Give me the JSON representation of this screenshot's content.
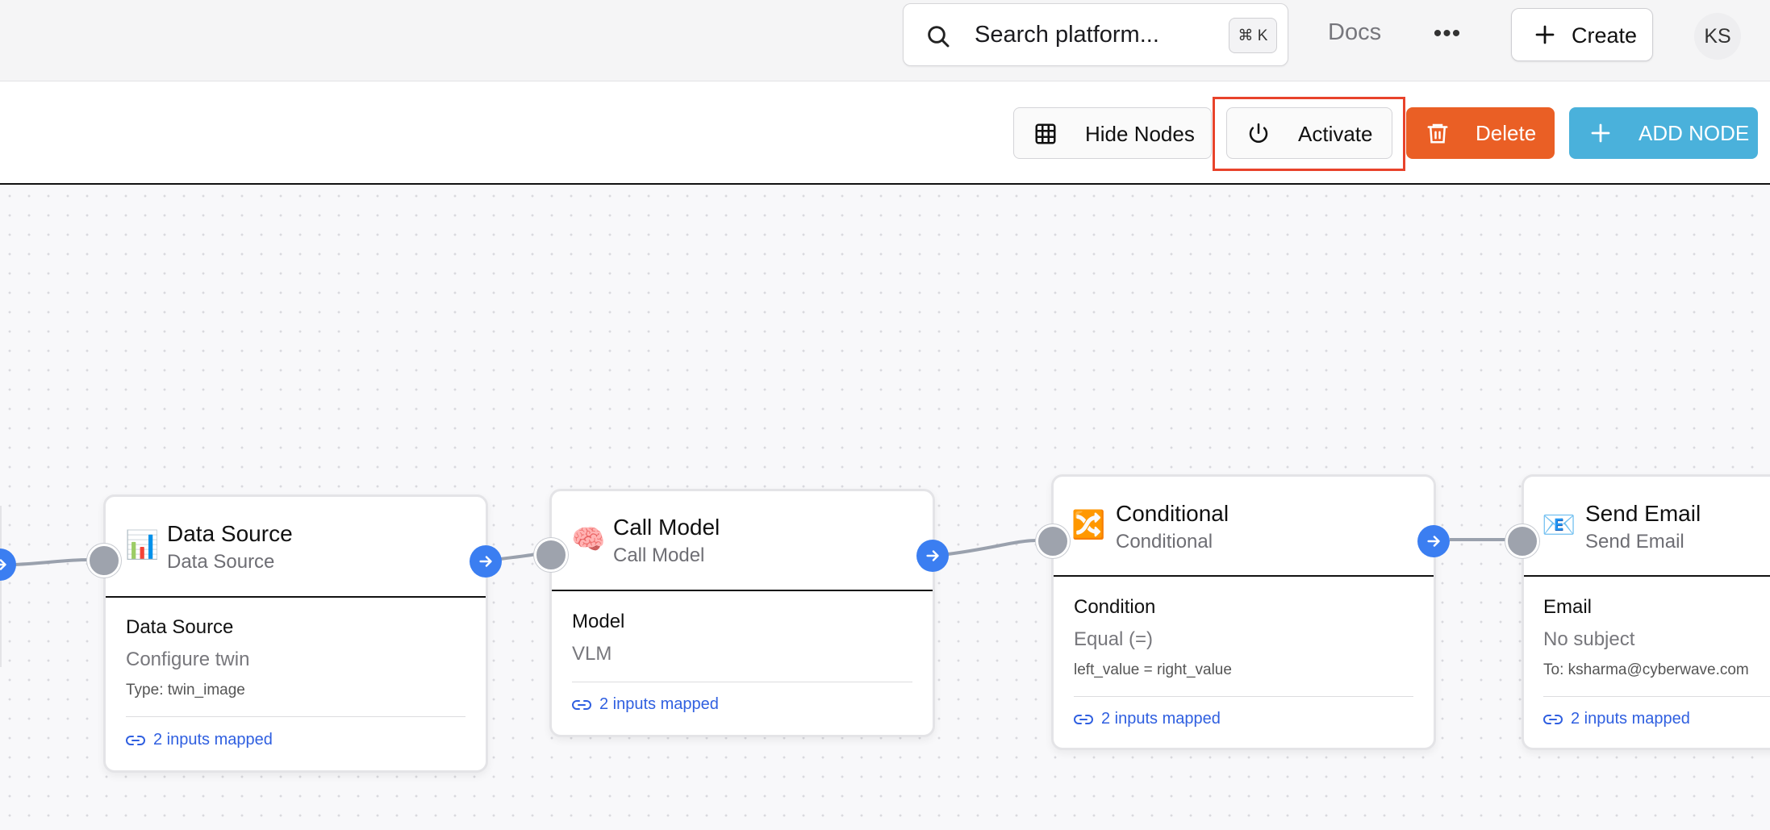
{
  "header": {
    "search_placeholder": "Search platform...",
    "search_shortcut": "⌘ K",
    "docs_label": "Docs",
    "more_label": "•••",
    "create_label": "Create",
    "avatar_initials": "KS"
  },
  "toolbar": {
    "hide_nodes_label": "Hide Nodes",
    "activate_label": "Activate",
    "delete_label": "Delete",
    "add_node_label": "ADD NODE"
  },
  "nodes": [
    {
      "icon": "📊",
      "title": "Data Source",
      "subtitle": "Data Source",
      "section_label": "Data Source",
      "value": "Configure twin",
      "meta": "Type: twin_image",
      "mapped": "2 inputs mapped"
    },
    {
      "icon": "🧠",
      "title": "Call Model",
      "subtitle": "Call Model",
      "section_label": "Model",
      "value": "VLM",
      "mapped": "2 inputs mapped"
    },
    {
      "icon": "🔀",
      "title": "Conditional",
      "subtitle": "Conditional",
      "section_label": "Condition",
      "value": "Equal (=)",
      "meta": "left_value = right_value",
      "mapped": "2 inputs mapped"
    },
    {
      "icon": "📧",
      "title": "Send Email",
      "subtitle": "Send Email",
      "section_label": "Email",
      "value": "No subject",
      "meta": "To: ksharma@cyberwave.com",
      "mapped": "2 inputs mapped"
    }
  ],
  "colors": {
    "delete": "#ea5f25",
    "add_node": "#4ab1db",
    "highlight": "#e8432b",
    "port_out": "#3b7ef1",
    "link": "#2f5fe0"
  }
}
